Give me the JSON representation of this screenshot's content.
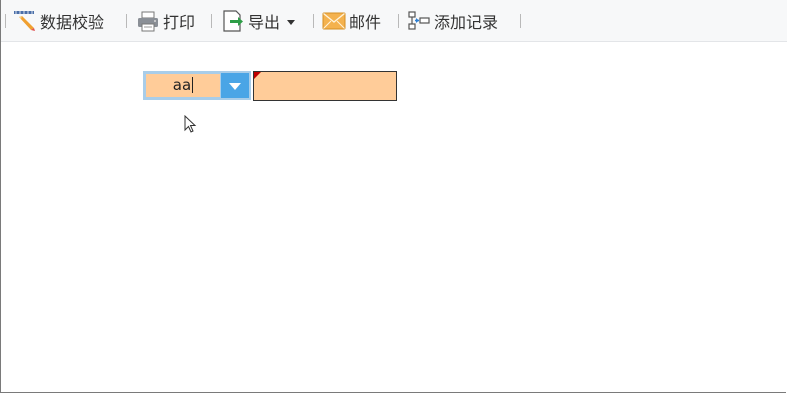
{
  "toolbar": {
    "items": [
      {
        "label": "数据校验",
        "icon": "pencil-ruler-icon"
      },
      {
        "label": "打印",
        "icon": "printer-icon"
      },
      {
        "label": "导出",
        "icon": "export-icon"
      },
      {
        "label": "邮件",
        "icon": "mail-icon"
      },
      {
        "label": "添加记录",
        "icon": "add-record-icon"
      }
    ]
  },
  "form": {
    "combo_value": "aa",
    "text_cell_value": ""
  },
  "colors": {
    "cell_fill": "#ffcc99",
    "combo_button": "#4aa5e6",
    "error_marker": "#c00000"
  }
}
